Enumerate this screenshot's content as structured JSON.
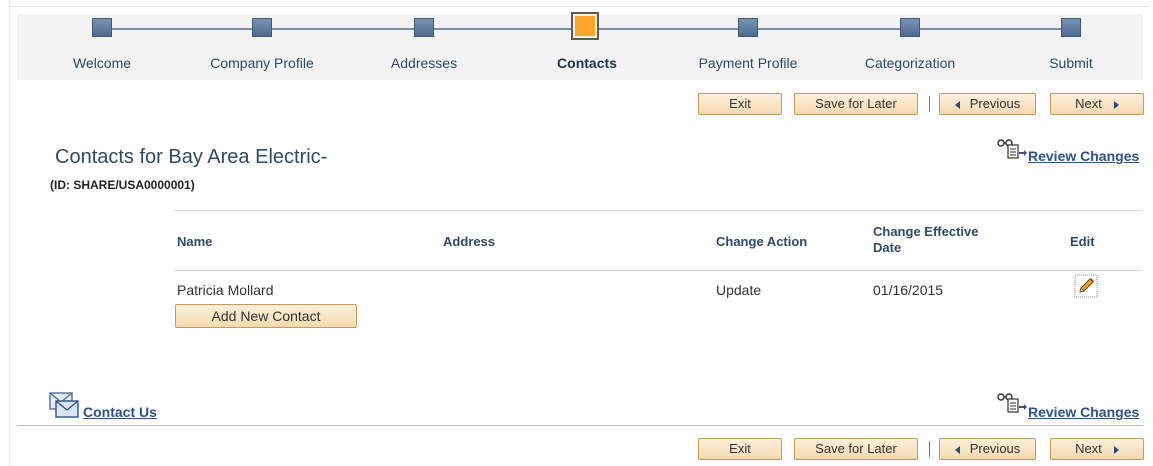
{
  "train": {
    "steps": [
      {
        "label": "Welcome",
        "active": false
      },
      {
        "label": "Company Profile",
        "active": false
      },
      {
        "label": "Addresses",
        "active": false
      },
      {
        "label": "Contacts",
        "active": true
      },
      {
        "label": "Payment Profile",
        "active": false
      },
      {
        "label": "Categorization",
        "active": false
      },
      {
        "label": "Submit",
        "active": false
      }
    ]
  },
  "toolbar": {
    "exit_label": "Exit",
    "save_label": "Save for Later",
    "previous_label": "Previous",
    "next_label": "Next"
  },
  "page": {
    "title": "Contacts for Bay Area Electric-",
    "subtitle": "(ID: SHARE/USA0000001)",
    "review_changes": "Review Changes"
  },
  "contacts_table": {
    "headers": {
      "name": "Name",
      "address": "Address",
      "change_action": "Change Action",
      "change_effective_date_line1": "Change Effective",
      "change_effective_date_line2": "Date",
      "edit": "Edit"
    },
    "rows": [
      {
        "name": "Patricia Mollard",
        "address": "",
        "change_action": "Update",
        "change_effective_date": "01/16/2015"
      }
    ],
    "add_label": "Add New Contact"
  },
  "footer": {
    "contact_us": "Contact Us",
    "review_changes": "Review Changes"
  },
  "icons": {
    "train_step": "train-step-icon",
    "edit": "pencil-icon",
    "review": "review-changes-icon",
    "mail": "envelope-icon",
    "previous": "triangle-left-icon",
    "next": "triangle-right-icon"
  },
  "colors": {
    "active_step": "#ffa62a",
    "inactive_step": "#5b7aa2",
    "button_bg": "#f6dfb8",
    "link": "#2c5288",
    "heading": "#2f4a68"
  }
}
